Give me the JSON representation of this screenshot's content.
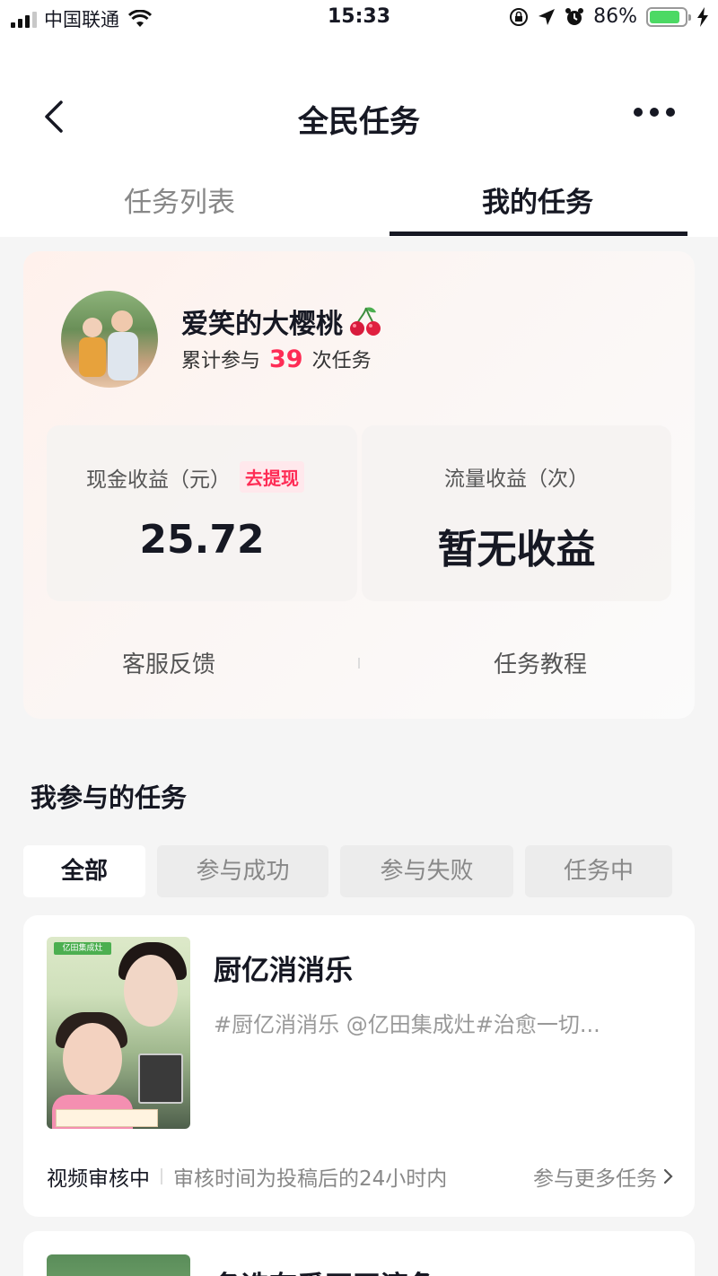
{
  "status_bar": {
    "carrier": "中国联通",
    "time": "15:33",
    "battery": "86%",
    "battery_level": 0.86
  },
  "nav": {
    "title": "全民任务"
  },
  "tabs": [
    {
      "label": "任务列表"
    },
    {
      "label": "我的任务"
    }
  ],
  "profile": {
    "name": "爱笑的大樱桃",
    "participation_prefix": "累计参与",
    "participation_count": "39",
    "participation_suffix": "次任务"
  },
  "earnings": {
    "cash_label": "现金收益（元）",
    "withdraw_label": "去提现",
    "cash_value": "25.72",
    "traffic_label": "流量收益（次）",
    "traffic_value": "暂无收益"
  },
  "links": {
    "service": "客服反馈",
    "tutorial": "任务教程"
  },
  "section": {
    "title": "我参与的任务"
  },
  "filters": [
    {
      "label": "全部"
    },
    {
      "label": "参与成功"
    },
    {
      "label": "参与失败"
    },
    {
      "label": "任务中"
    }
  ],
  "task": {
    "name": "厨亿消消乐",
    "description": "#厨亿消消乐 @亿田集成灶#治愈一切...",
    "status": "视频审核中",
    "note": "审核时间为投稿后的24小时内",
    "more": "参与更多任务",
    "thumb_banner": "亿田集成灶"
  },
  "task2": {
    "name": "备选有番正田滚角"
  },
  "colors": {
    "accent": "#fe2c55",
    "text": "#161823",
    "background": "#f5f5f5"
  }
}
